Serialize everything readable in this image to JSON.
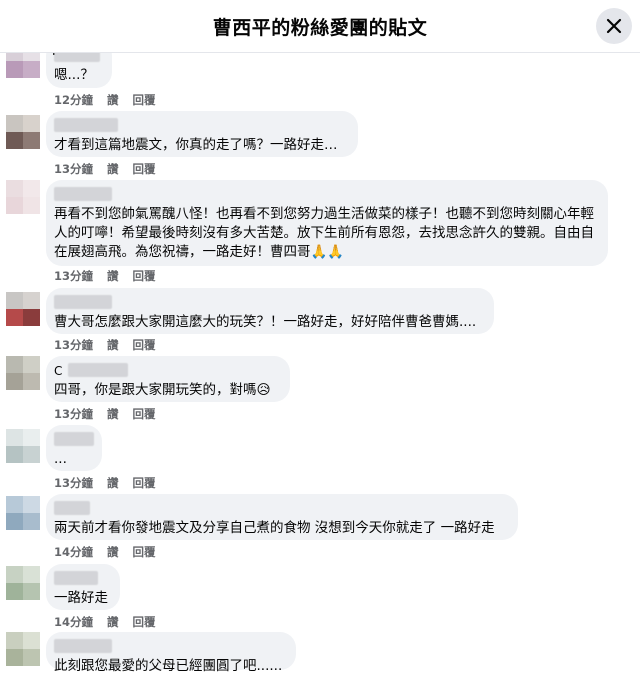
{
  "header": {
    "title": "曹西平的粉絲愛團的貼文",
    "close_icon": "close-icon"
  },
  "actions": {
    "like": "讚",
    "reply": "回覆"
  },
  "colors": {
    "bubble": "#f0f2f5",
    "meta": "#65676b",
    "close_bg": "#e4e6eb"
  },
  "comments": [
    {
      "initial": "F",
      "text": "嗯...？",
      "time": "12分鐘",
      "avatar": [
        "#d8cfd8",
        "#e6e0e6",
        "#b99ab8",
        "#c7adc6"
      ]
    },
    {
      "initial": "",
      "text": "才看到這篇地震文，你真的走了嗎？一路好走…",
      "time": "13分鐘",
      "avatar": [
        "#c9c5c0",
        "#d8d2cc",
        "#6f5a55",
        "#8d7a74"
      ]
    },
    {
      "initial": "",
      "text": "再看不到您帥氣罵醜八怪！也再看不到您努力過生活做菜的樣子！也聽不到您時刻關心年輕人的叮嚀！希望最後時刻沒有多大苦楚。放下生前所有恩怨，去找思念許久的雙親。自由自在展翅高飛。為您祝禱，一路走好！曹四哥🙏🙏",
      "time": "13分鐘",
      "avatar": [
        "#eadde0",
        "#f2e8ea",
        "#e8d6da",
        "#f0e4e6"
      ]
    },
    {
      "initial": "",
      "text": "曹大哥怎麼跟大家開這麼大的玩笑？！一路好走，好好陪伴曹爸曹媽....",
      "time": "13分鐘",
      "avatar": [
        "#c8c6c4",
        "#d6d2cf",
        "#b54a4a",
        "#8a3c3c"
      ]
    },
    {
      "initial": "C",
      "text": "四哥，你是跟大家開玩笑的，對嗎😥",
      "time": "13分鐘",
      "avatar": [
        "#b9b9b0",
        "#cfcfc6",
        "#a5a297",
        "#bdbab0"
      ]
    },
    {
      "initial": "",
      "text": "...",
      "time": "13分鐘",
      "avatar": [
        "#dde4e4",
        "#e9eeee",
        "#b5c3c3",
        "#c8d2d2"
      ]
    },
    {
      "initial": "",
      "text": "兩天前才看你發地震文及分享自己煮的食物 沒想到今天你就走了 一路好走",
      "time": "14分鐘",
      "avatar": [
        "#b7c9d8",
        "#cdd9e4",
        "#8fa9be",
        "#a8bccd"
      ]
    },
    {
      "initial": "",
      "text": "一路好走",
      "time": "14分鐘",
      "avatar": [
        "#c7d2c3",
        "#d9e1d6",
        "#9fb39a",
        "#b5c4b0"
      ]
    },
    {
      "initial": "",
      "text": "此刻跟您最愛的父母已經團圓了吧......",
      "time": "",
      "avatar": [
        "#c9cfbf",
        "#dbe0d3",
        "#a9b39b",
        "#bdc5b1"
      ]
    }
  ]
}
